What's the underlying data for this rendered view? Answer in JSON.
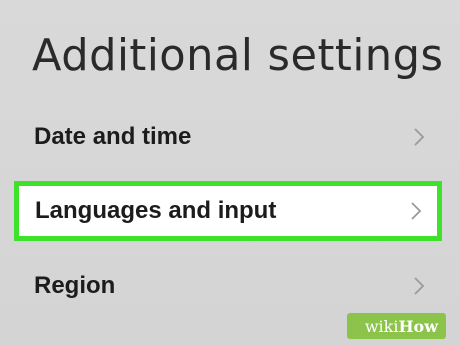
{
  "header": {
    "title": "Additional settings"
  },
  "settings": {
    "items": [
      {
        "label": "Date and time",
        "highlighted": false,
        "icon": "chevron-right-icon"
      },
      {
        "label": "Languages and input",
        "highlighted": true,
        "icon": "chevron-right-icon"
      },
      {
        "label": "Region",
        "highlighted": false,
        "icon": "chevron-right-icon"
      }
    ]
  },
  "watermark": {
    "brand_part1": "wiki",
    "brand_part2": "How"
  },
  "colors": {
    "background": "#d6d6d6",
    "highlight_border": "#3fe22a",
    "highlight_background": "#ffffff",
    "watermark_background": "#8cc34a",
    "chevron": "#9a9a9a"
  }
}
